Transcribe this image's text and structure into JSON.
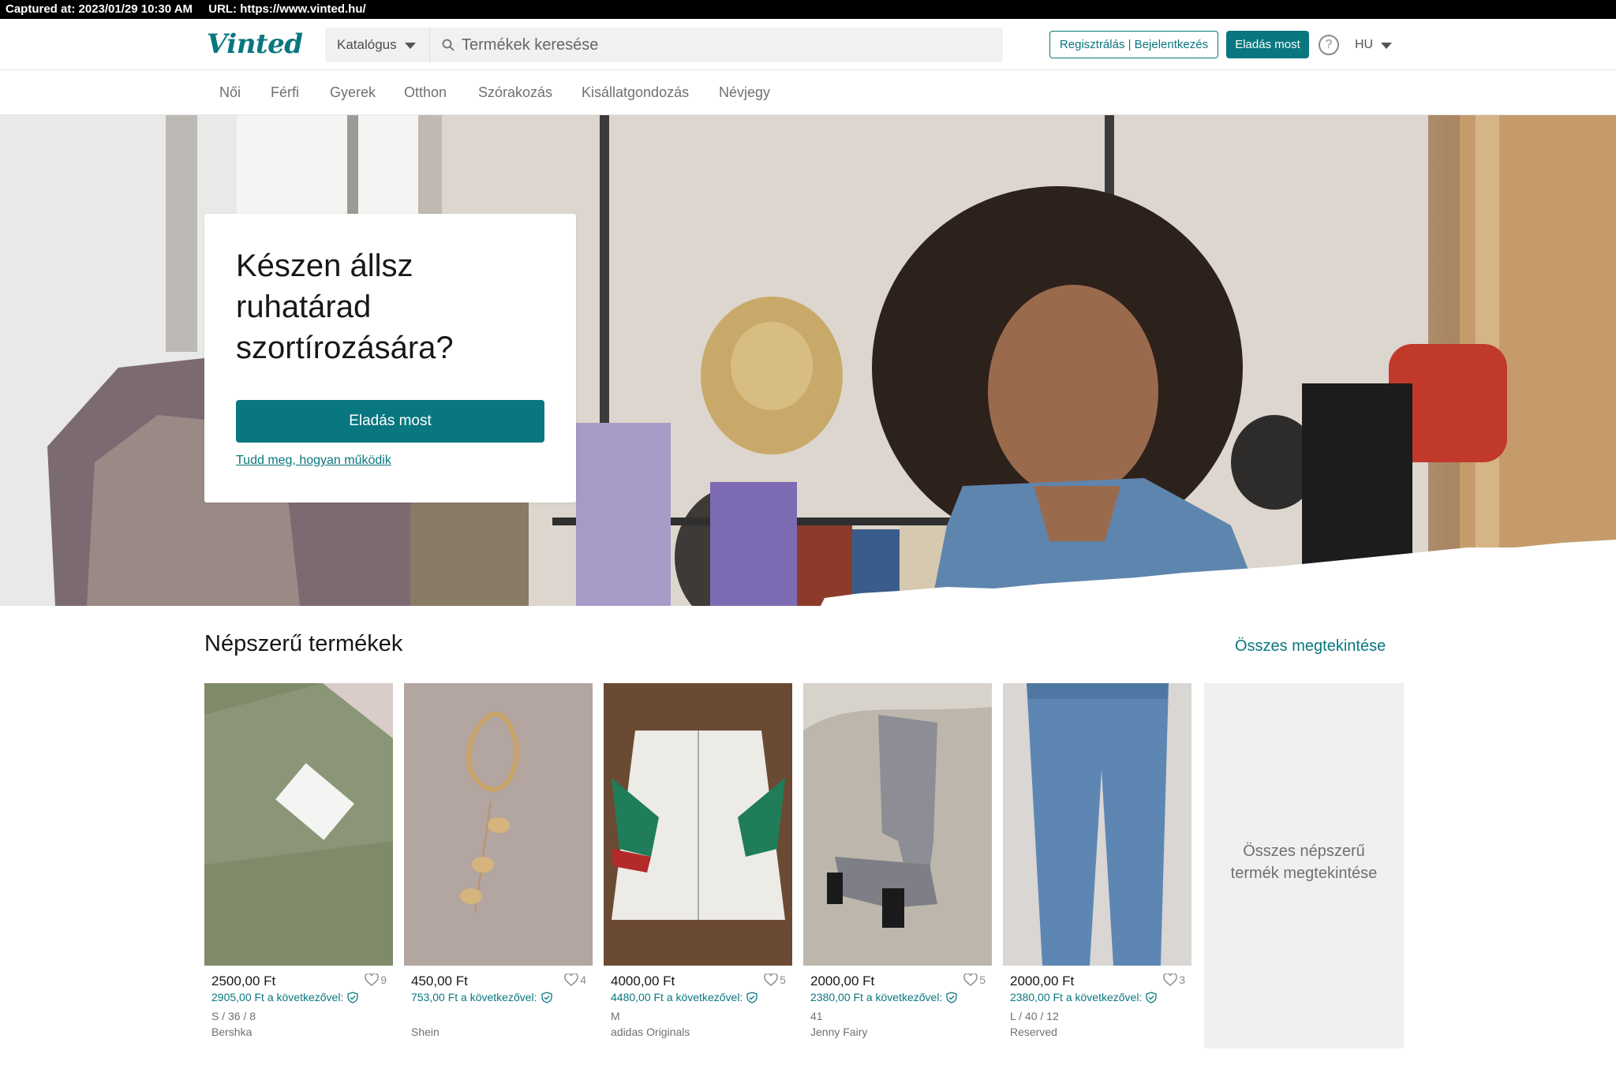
{
  "capture": {
    "captured_at": "Captured at: 2023/01/29 10:30 AM",
    "url": "URL: https://www.vinted.hu/"
  },
  "header": {
    "logo": "Vinted",
    "catalog_label": "Katalógus",
    "search_placeholder": "Termékek keresése",
    "auth_label": "Regisztrálás | Bejelentkezés",
    "sell_label": "Eladás most",
    "help_icon": "question-circle-icon",
    "language": "HU"
  },
  "nav": {
    "items": [
      "Női",
      "Férfi",
      "Gyerek",
      "Otthon",
      "Szórakozás",
      "Kisállatgondozás",
      "Névjegy"
    ]
  },
  "hero": {
    "title": "Készen állsz ruhatárad szortírozására?",
    "button": "Eladás most",
    "link": "Tudd meg, hogyan működik"
  },
  "popular": {
    "title": "Népszerű termékek",
    "see_all": "Összes megtekintése",
    "all_tile": "Összes népszerű termék megtekintése",
    "items": [
      {
        "price": "2500,00 Ft",
        "favorites": "9",
        "buyer_price": "2905,00 Ft a következővel:",
        "size": "S / 36 / 8",
        "brand": "Bershka"
      },
      {
        "price": "450,00 Ft",
        "favorites": "4",
        "buyer_price": "753,00 Ft a következővel:",
        "size": "",
        "brand": "Shein"
      },
      {
        "price": "4000,00 Ft",
        "favorites": "5",
        "buyer_price": "4480,00 Ft a következővel:",
        "size": "M",
        "brand": "adidas Originals"
      },
      {
        "price": "2000,00 Ft",
        "favorites": "5",
        "buyer_price": "2380,00 Ft a következővel:",
        "size": "41",
        "brand": "Jenny Fairy"
      },
      {
        "price": "2000,00 Ft",
        "favorites": "3",
        "buyer_price": "2380,00 Ft a következővel:",
        "size": "L / 40 / 12",
        "brand": "Reserved"
      }
    ]
  },
  "colors": {
    "brand": "#09777f",
    "text": "#171717",
    "muted": "#707070"
  }
}
